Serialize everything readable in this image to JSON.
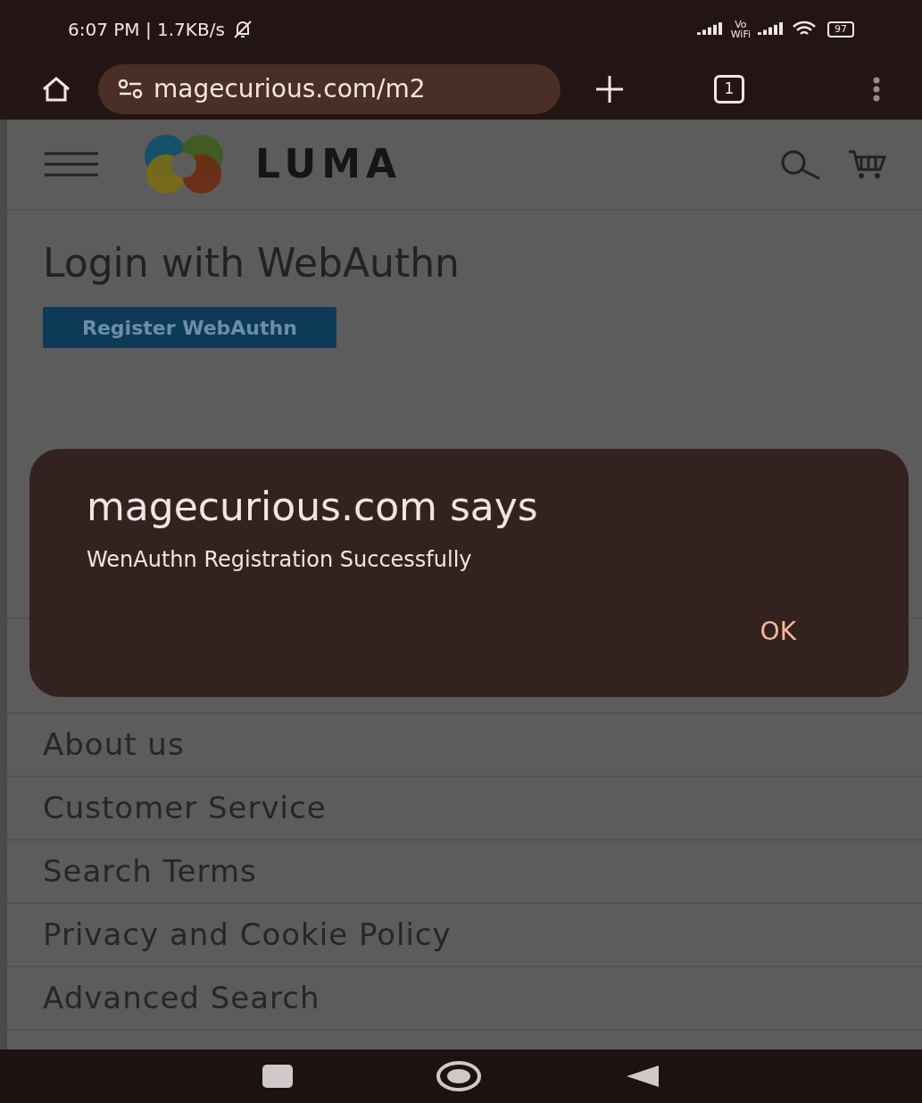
{
  "status_bar": {
    "time": "6:07 PM | 1.7KB/s",
    "network": "Vo\nWiFi",
    "battery": "97"
  },
  "browser": {
    "url": "magecurious.com/m2",
    "tab_count": "1"
  },
  "site": {
    "logo_text": "LUMA",
    "heading": "Login with WebAuthn",
    "register_button": "Register WebAuthn"
  },
  "footer_links": [
    "About us",
    "Customer Service",
    "Search Terms",
    "Privacy and Cookie Policy",
    "Advanced Search"
  ],
  "dialog": {
    "title": "magecurious.com says",
    "message": "WenAuthn Registration Successfully",
    "ok_button": "OK"
  }
}
